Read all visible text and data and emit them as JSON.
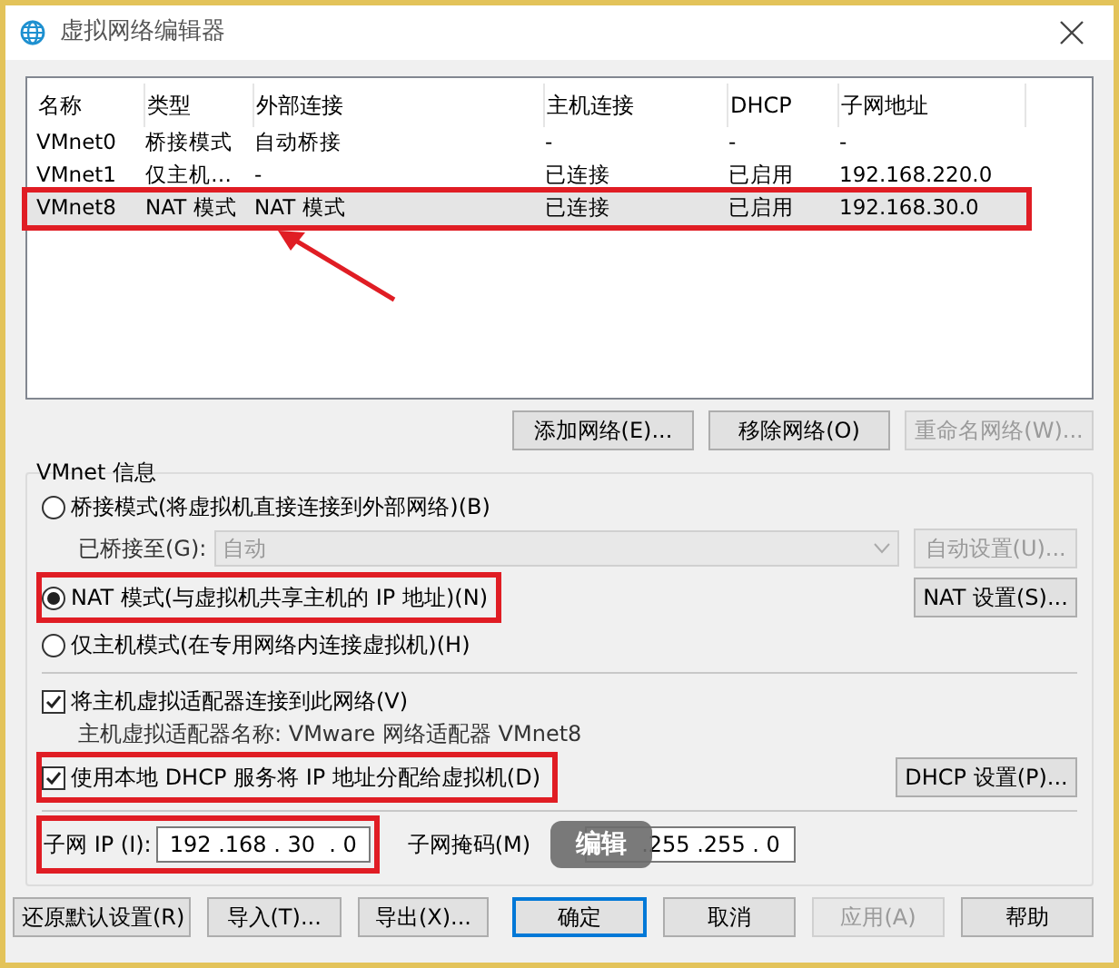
{
  "window": {
    "title": "虚拟网络编辑器"
  },
  "table": {
    "columns": [
      "名称",
      "类型",
      "外部连接",
      "主机连接",
      "DHCP",
      "子网地址"
    ],
    "rows": [
      {
        "cells": [
          "VMnet0",
          "桥接模式",
          "自动桥接",
          "-",
          "-",
          "-"
        ],
        "selected": false,
        "highlighted": false
      },
      {
        "cells": [
          "VMnet1",
          "仅主机…",
          "-",
          "已连接",
          "已启用",
          "192.168.220.0"
        ],
        "selected": false,
        "highlighted": false
      },
      {
        "cells": [
          "VMnet8",
          "NAT 模式",
          "NAT 模式",
          "已连接",
          "已启用",
          "192.168.30.0"
        ],
        "selected": true,
        "highlighted": true
      }
    ]
  },
  "network_buttons": [
    {
      "label": "添加网络(E)...",
      "disabled": false
    },
    {
      "label": "移除网络(O)",
      "disabled": false
    },
    {
      "label": "重命名网络(W)...",
      "disabled": true
    }
  ],
  "vmnet_info": {
    "title": "VMnet 信息",
    "modes": [
      {
        "label": "桥接模式(将虚拟机直接连接到外部网络)(B)",
        "selected": false,
        "highlighted": false
      },
      {
        "label": "NAT 模式(与虚拟机共享主机的 IP 地址)(N)",
        "selected": true,
        "highlighted": true
      },
      {
        "label": "仅主机模式(在专用网络内连接虚拟机)(H)",
        "selected": false,
        "highlighted": false
      }
    ],
    "bridged_to": {
      "label": "已桥接至(G):",
      "value": "自动",
      "disabled": true
    },
    "auto_settings_button": {
      "label": "自动设置(U)...",
      "disabled": true
    },
    "nat_settings_button": {
      "label": "NAT 设置(S)...",
      "disabled": false
    },
    "connect_adapter": {
      "label": "将主机虚拟适配器连接到此网络(V)",
      "checked": true,
      "highlighted": false
    },
    "adapter_name": "主机虚拟适配器名称: VMware 网络适配器 VMnet8",
    "use_dhcp": {
      "label": "使用本地 DHCP 服务将 IP 地址分配给虚拟机(D)",
      "checked": true,
      "highlighted": true
    },
    "dhcp_settings_button": {
      "label": "DHCP 设置(P)...",
      "disabled": false
    },
    "subnet_ip": {
      "label": "子网 IP (I):",
      "value": "192 .168 . 30  . 0",
      "highlighted": true
    },
    "subnet_mask": {
      "label": "子网掩码(M)",
      "value": ".255 .255 . 0"
    },
    "tooltip": "编辑"
  },
  "footer_buttons": [
    {
      "label": "还原默认设置(R)",
      "disabled": false,
      "default": false
    },
    {
      "label": "导入(T)...",
      "disabled": false,
      "default": false
    },
    {
      "label": "导出(X)...",
      "disabled": false,
      "default": false
    },
    {
      "label": "确定",
      "disabled": false,
      "default": true
    },
    {
      "label": "取消",
      "disabled": false,
      "default": false
    },
    {
      "label": "应用(A)",
      "disabled": true,
      "default": false
    },
    {
      "label": "帮助",
      "disabled": false,
      "default": false
    }
  ]
}
